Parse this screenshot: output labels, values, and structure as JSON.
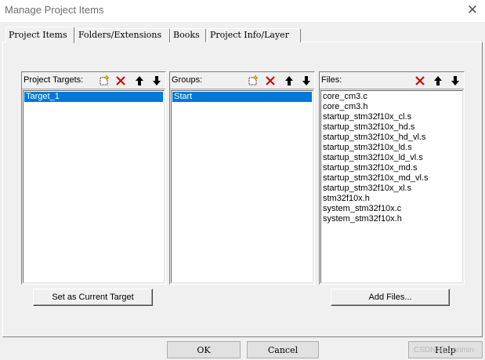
{
  "window": {
    "title": "Manage Project Items"
  },
  "tabs": [
    {
      "label": "Project Items"
    },
    {
      "label": "Folders/Extensions"
    },
    {
      "label": "Books"
    },
    {
      "label": "Project Info/Layer"
    }
  ],
  "targets": {
    "label": "Project Targets:",
    "items": [
      "Target_1"
    ],
    "selected": "Target_1"
  },
  "groups": {
    "label": "Groups:",
    "items": [
      "Start"
    ],
    "selected": "Start"
  },
  "files": {
    "label": "Files:",
    "items": [
      "core_cm3.c",
      "core_cm3.h",
      "startup_stm32f10x_cl.s",
      "startup_stm32f10x_hd.s",
      "startup_stm32f10x_hd_vl.s",
      "startup_stm32f10x_ld.s",
      "startup_stm32f10x_ld_vl.s",
      "startup_stm32f10x_md.s",
      "startup_stm32f10x_md_vl.s",
      "startup_stm32f10x_xl.s",
      "stm32f10x.h",
      "system_stm32f10x.c",
      "system_stm32f10x.h"
    ]
  },
  "buttons": {
    "set_current_target": "Set as Current Target",
    "add_files": "Add Files...",
    "ok": "OK",
    "cancel": "Cancel",
    "help": "Help"
  },
  "watermark": "CSDN @...anmin",
  "colors": {
    "selection": "#0078d7",
    "delete_red": "#cc0000"
  }
}
